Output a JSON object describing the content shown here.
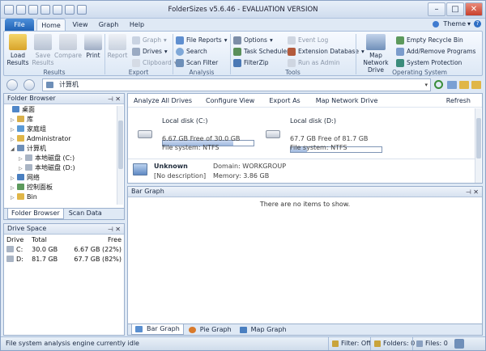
{
  "app": {
    "title": "FolderSizes v5.6.46 - EVALUATION VERSION"
  },
  "ribbon_tabs": {
    "file": "File",
    "home": "Home",
    "view": "View",
    "graph": "Graph",
    "help": "Help",
    "theme": "Theme"
  },
  "ribbon": {
    "results": {
      "label": "Results",
      "large_buttons": [
        "Load Results",
        "Save Results",
        "Compare",
        "Print"
      ]
    },
    "export": {
      "label": "Export",
      "report": "Report",
      "items": [
        "Graph",
        "Drives",
        "Clipboard"
      ]
    },
    "analysis": {
      "label": "Analysis",
      "items": [
        "File Reports",
        "Search",
        "Scan Filter"
      ]
    },
    "tools": {
      "label": "Tools",
      "col1": [
        "Options",
        "Task Scheduler",
        "FilterZip"
      ],
      "col2": [
        "Event Log",
        "Extension Database",
        "Run as Admin"
      ]
    },
    "operating_system": {
      "label": "Operating System",
      "map_drive": "Map Network Drive",
      "items": [
        "Empty Recycle Bin",
        "Add/Remove Programs",
        "System Protection"
      ]
    }
  },
  "address": {
    "path": "计算机"
  },
  "folder_browser": {
    "title": "Folder Browser",
    "tree": [
      "桌面",
      "库",
      "家庭组",
      "Administrator",
      "计算机",
      "本地磁盘 (C:)",
      "本地磁盘 (D:)",
      "网络",
      "控制面板",
      "Bin"
    ],
    "tabs": [
      "Folder Browser",
      "Scan Data"
    ]
  },
  "drive_space": {
    "title": "Drive Space",
    "columns": [
      "Drive",
      "Total",
      "Free"
    ],
    "rows": [
      {
        "drive": "C:",
        "total": "30.0 GB",
        "free": "6.67 GB (22%)"
      },
      {
        "drive": "D:",
        "total": "81.7 GB",
        "free": "67.7 GB (82%)"
      }
    ]
  },
  "main_toolbar": {
    "items": [
      "Analyze All Drives",
      "Configure View",
      "Export As",
      "Map Network Drive"
    ],
    "refresh": "Refresh"
  },
  "disks": [
    {
      "name": "Local disk (C:)",
      "free_text": "6.67 GB Free of 30.0 GB",
      "fs": "File system: NTFS",
      "used_fraction": 0.78
    },
    {
      "name": "Local disk (D:)",
      "free_text": "67.7 GB Free of 81.7 GB",
      "fs": "File system: NTFS",
      "used_fraction": 0.18
    }
  ],
  "computer": {
    "name": "Unknown",
    "description": "[No description]",
    "domain": "Domain: WORKGROUP",
    "memory": "Memory: 3.86 GB"
  },
  "bar_graph": {
    "title": "Bar Graph",
    "empty": "There are no items to show.",
    "tabs": [
      "Bar Graph",
      "Pie Graph",
      "Map Graph"
    ]
  },
  "status": {
    "message": "File system analysis engine currently idle",
    "filter": "Filter: Off",
    "folders": "Folders: 0",
    "files": "Files: 0"
  }
}
